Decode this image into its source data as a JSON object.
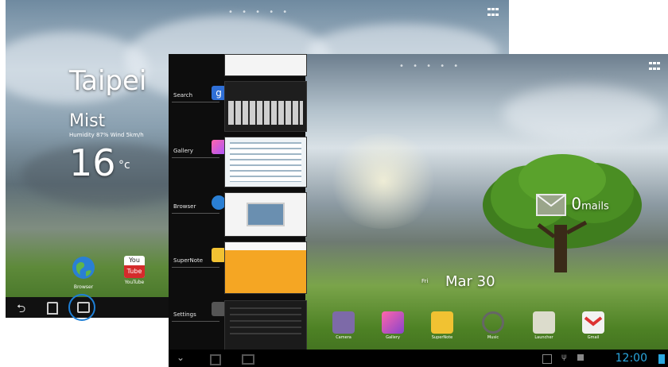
{
  "back_screen": {
    "city": "Taipei",
    "weather": "Mist",
    "weather_detail": "Humidity 87% Wind 5km/h",
    "temperature": "16",
    "temperature_unit": "°c",
    "apps": [
      {
        "label": "Browser",
        "icon": "globe-icon"
      },
      {
        "label": "YouTube",
        "icon": "youtube-icon"
      }
    ],
    "youtube_top": "You",
    "youtube_bottom": "Tube",
    "nav": [
      "back-icon",
      "home-icon",
      "recent-apps-icon"
    ],
    "highlight_color": "#1e7fd6"
  },
  "front_screen": {
    "recents": [
      {
        "label": "Search",
        "icon": "google-search-icon",
        "icon_letter": "g"
      },
      {
        "label": "Gallery",
        "icon": "gallery-icon"
      },
      {
        "label": "Browser",
        "icon": "globe-icon"
      },
      {
        "label": "SuperNote",
        "icon": "supernote-icon"
      },
      {
        "label": "Settings",
        "icon": "settings-icon"
      }
    ],
    "mail_count": "0",
    "mail_label": "mails",
    "date_day": "Fri",
    "date_text": "Mar 30",
    "dock": [
      {
        "label": "Camera",
        "icon": "camera-icon",
        "color": "#8a6fb0"
      },
      {
        "label": "Gallery",
        "icon": "gallery-icon",
        "color": "#c06090"
      },
      {
        "label": "SuperNote",
        "icon": "supernote-icon",
        "color": "#f0c030"
      },
      {
        "label": "Music",
        "icon": "headphones-icon",
        "color": "#5a5a5a"
      },
      {
        "label": "Launcher",
        "icon": "launcher-icon",
        "color": "#d8d8c8"
      },
      {
        "label": "Gmail",
        "icon": "gmail-icon",
        "color": "#e8e8e8"
      }
    ],
    "clock": "12:00",
    "accent": "#2aa8e0"
  }
}
